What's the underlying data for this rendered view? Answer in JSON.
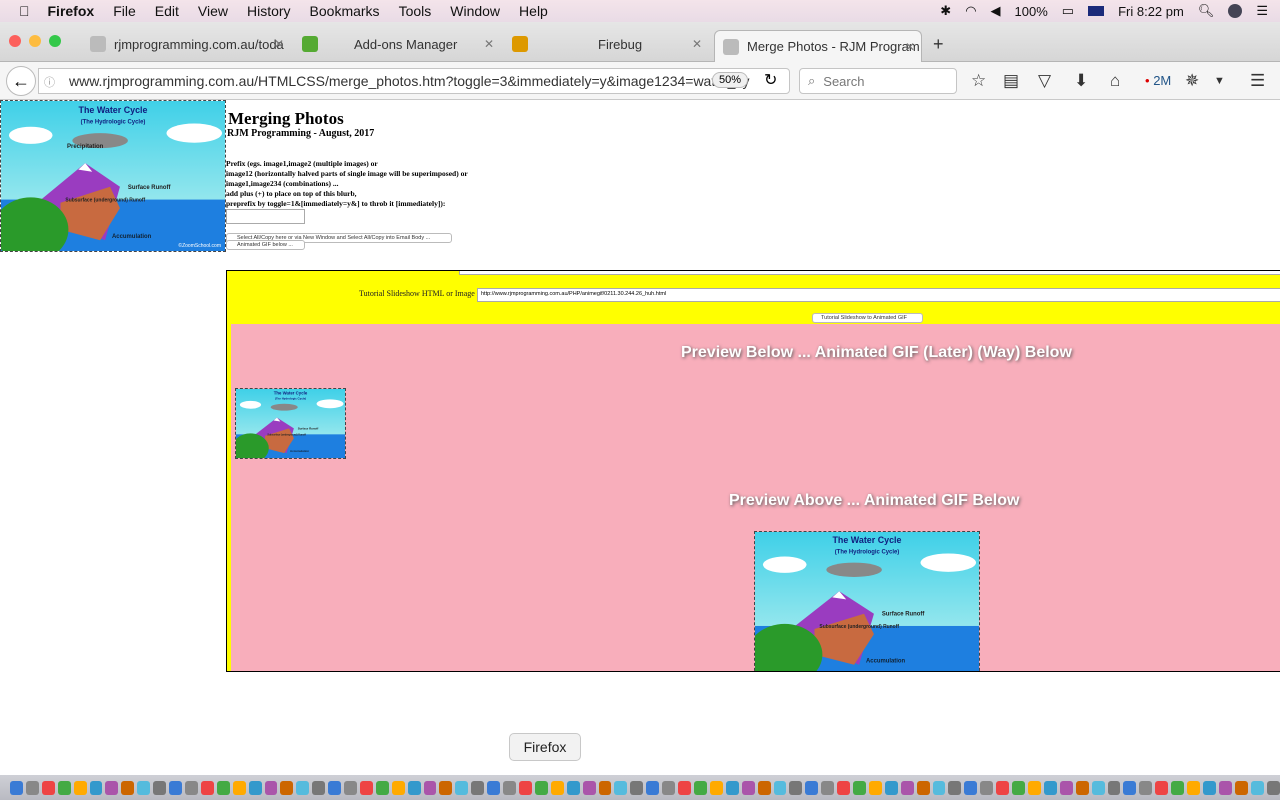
{
  "menubar": {
    "app": "Firefox",
    "items": [
      "File",
      "Edit",
      "View",
      "History",
      "Bookmarks",
      "Tools",
      "Window",
      "Help"
    ],
    "battery": "100%",
    "clock": "Fri 8:22 pm"
  },
  "tabs": [
    {
      "label": "rjmprogramming.com.au/toda",
      "active": false
    },
    {
      "label": "Add-ons Manager",
      "active": false
    },
    {
      "label": "Firebug",
      "active": false
    },
    {
      "label": "Merge Photos - RJM Program",
      "active": true
    }
  ],
  "navbar": {
    "url": "www.rjmprogramming.com.au/HTMLCSS/merge_photos.htm?toggle=3&immediately=y&image1234=water_cy",
    "zoom": "50%",
    "search_placeholder": "Search",
    "badge": "2M"
  },
  "page": {
    "title": "Merging Photos",
    "subtitle": "RJM Programming - August, 2017",
    "blurb": [
      "Prefix (egs. image1,image2 (multiple images) or",
      "image12 (horizontally halved parts of single image will be superimposed) or",
      "image1,image234 (combinations) ...",
      "add plus (+) to place on top of this blurb,",
      "preprefix by toggle=1&[immediately=y&] to throb it [immediately]):"
    ],
    "prefix_value": "",
    "select_all_button": "Select All/Copy here or via New Window and Select All/Copy into Email Body ...",
    "animated_gif_button": "Animated GIF below ...",
    "slideshow_label": "Tutorial Slideshow HTML or Image",
    "slideshow_value": "http://www.rjmprogramming.com.au/PHP/animegif/0211.30.244.26_huh.html",
    "slideshow_button": "Tutorial Slideshow to Animated GIF",
    "preview_below": "Preview Below ... Animated GIF (Later) (Way) Below",
    "preview_above": "Preview Above ... Animated GIF Below"
  },
  "image": {
    "title": "The Water Cycle",
    "subtitle": "(The Hydrologic Cycle)",
    "labels": [
      "Precipitation",
      "Surface Runoff",
      "Subsurface (underground) Runoff",
      "Accumulation"
    ],
    "credit": "©ZoomSchool.com"
  },
  "tooltip": "Firefox"
}
